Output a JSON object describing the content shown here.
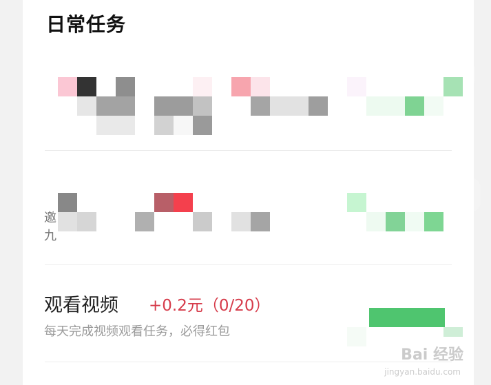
{
  "section": {
    "title": "日常任务"
  },
  "tasks": [
    {
      "title": "观看视频",
      "reward": "+0.2元（0/20）",
      "description": "每天完成视频观看任务，必得红包"
    }
  ],
  "fragments": [
    "邀",
    "九"
  ],
  "watermark": {
    "brand": "Bai 经验",
    "url": "jingyan.baidu.com"
  }
}
